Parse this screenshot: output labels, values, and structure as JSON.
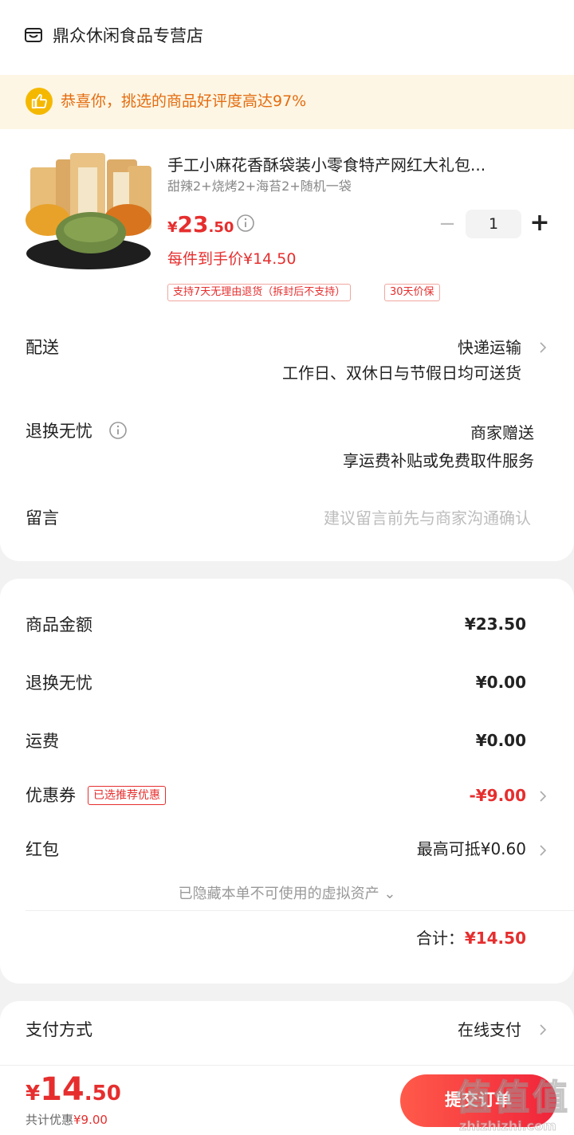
{
  "shop": {
    "name": "鼎众休闲食品专营店",
    "icon": "shop-icon"
  },
  "banner": {
    "icon": "thumbs-up-icon",
    "text": "恭喜你，挑选的商品好评度高达97%"
  },
  "product": {
    "title": "手工小麻花香酥袋装小零食特产网红大礼包...",
    "spec": "甜辣2+烧烤2+海苔2+随机一袋",
    "price_symbol": "¥",
    "price_int": "23",
    "price_dec": ".50",
    "unit_price": "每件到手价¥14.50",
    "tags": [
      "支持7天无理由退货（拆封后不支持）",
      "30天价保"
    ],
    "quantity": "1"
  },
  "options": {
    "delivery_label": "配送",
    "delivery_value": "快递运输",
    "delivery_note": "工作日、双休日与节假日均可送货",
    "return_label": "退换无忧",
    "return_value": "商家赠送",
    "return_note": "享运费补贴或免费取件服务",
    "message_label": "留言",
    "message_placeholder": "建议留言前先与商家沟通确认"
  },
  "summary": {
    "goods_label": "商品金额",
    "goods_value": "¥23.50",
    "return_label": "退换无忧",
    "return_value": "¥0.00",
    "shipping_label": "运费",
    "shipping_value": "¥0.00",
    "coupon_label": "优惠券",
    "coupon_tag": "已选推荐优惠",
    "coupon_value": "-¥9.00",
    "redpacket_label": "红包",
    "redpacket_value": "最高可抵¥0.60",
    "hidden_assets": "已隐藏本单不可使用的虚拟资产 ⌄",
    "total_label": "合计：",
    "total_value": "¥14.50"
  },
  "payment": {
    "label": "支付方式",
    "value": "在线支付"
  },
  "bottom": {
    "price_symbol": "¥",
    "price_int": "14",
    "price_dec": ".50",
    "discount_label": "共计优惠",
    "discount_value": "¥9.00",
    "submit_label": "提交订单"
  },
  "watermark": {
    "text": "值",
    "site": "zhizhizhi.com"
  },
  "colors": {
    "accent": "#e62e2e",
    "banner_bg": "#fdf6e4",
    "banner_text": "#e46c10"
  }
}
